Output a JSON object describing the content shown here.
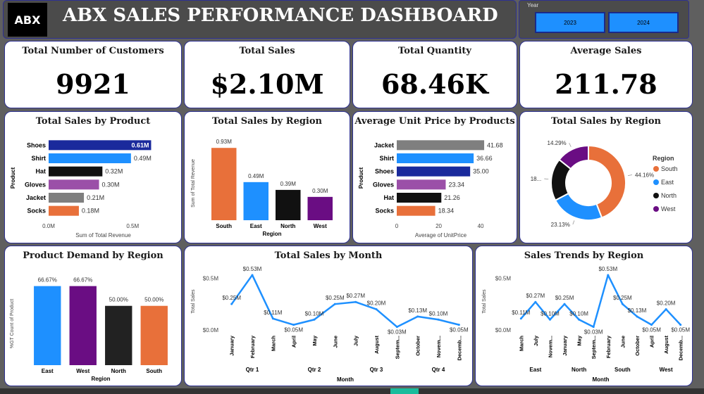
{
  "header": {
    "logo_text": "ABX",
    "title": "ABX SALES PERFORMANCE DASHBOARD"
  },
  "slicer": {
    "label": "Year",
    "options": [
      "2023",
      "2024"
    ]
  },
  "colors": {
    "accent_blue": "#1e90ff",
    "navy": "#1a2a9c",
    "orange": "#e8703a",
    "black": "#111111",
    "purple": "#6a0d83",
    "gray": "#7f7f7f",
    "violet": "#9b4fa8"
  },
  "kpis": [
    {
      "title": "Total Number of Customers",
      "value": "9921"
    },
    {
      "title": "Total Sales",
      "value": "$2.10M"
    },
    {
      "title": "Total Quantity",
      "value": "68.46K"
    },
    {
      "title": "Average Sales",
      "value": "211.78"
    }
  ],
  "chart_data": [
    {
      "id": "product",
      "type": "bar",
      "title": "Total Sales by Product",
      "orientation": "horizontal",
      "categories": [
        "Shoes",
        "Shirt",
        "Hat",
        "Gloves",
        "Jacket",
        "Socks"
      ],
      "values": [
        0.61,
        0.49,
        0.32,
        0.3,
        0.21,
        0.18
      ],
      "labels": [
        "0.61M",
        "0.49M",
        "0.32M",
        "0.30M",
        "0.21M",
        "0.18M"
      ],
      "colors": [
        "#1a2a9c",
        "#1e90ff",
        "#111111",
        "#9b4fa8",
        "#7f7f7f",
        "#e8703a"
      ],
      "xlabel": "Sum of Total Revenue",
      "ylabel": "Product",
      "xticks": [
        "0.0M",
        "0.5M"
      ],
      "xlim": [
        0,
        0.65
      ]
    },
    {
      "id": "region",
      "type": "bar",
      "title": "Total Sales by Region",
      "categories": [
        "South",
        "East",
        "North",
        "West"
      ],
      "values": [
        0.93,
        0.49,
        0.39,
        0.3
      ],
      "labels": [
        "0.93M",
        "0.49M",
        "0.39M",
        "0.30M"
      ],
      "colors": [
        "#e8703a",
        "#1e90ff",
        "#111111",
        "#6a0d83"
      ],
      "xlabel": "Region",
      "ylabel": "Sum of Total Revenue",
      "ylim": [
        0,
        0.95
      ]
    },
    {
      "id": "price",
      "type": "bar",
      "title": "Average Unit Price by Products",
      "orientation": "horizontal",
      "categories": [
        "Jacket",
        "Shirt",
        "Shoes",
        "Gloves",
        "Hat",
        "Socks"
      ],
      "values": [
        41.68,
        36.66,
        35.0,
        23.34,
        21.26,
        18.34
      ],
      "labels": [
        "41.68",
        "36.66",
        "35.00",
        "23.34",
        "21.26",
        "18.34"
      ],
      "colors": [
        "#7f7f7f",
        "#1e90ff",
        "#1a2a9c",
        "#9b4fa8",
        "#111111",
        "#e8703a"
      ],
      "xlabel": "Average of UnitPrice",
      "ylabel": "Product",
      "xticks": [
        "0",
        "20",
        "40"
      ],
      "xtick_values": [
        0,
        20,
        40
      ],
      "xlim": [
        0,
        42
      ]
    },
    {
      "id": "donut",
      "type": "pie",
      "title": "Total Sales by Region",
      "categories": [
        "South",
        "East",
        "North",
        "West"
      ],
      "values": [
        44.16,
        23.13,
        18.42,
        14.29
      ],
      "labels": [
        "44.16%",
        "23.13%",
        "18...",
        "14.29%"
      ],
      "colors": [
        "#e8703a",
        "#1e90ff",
        "#111111",
        "#6a0d83"
      ],
      "legend_title": "Region",
      "legend_position": "right"
    },
    {
      "id": "demand",
      "type": "bar",
      "title": "Product Demand by Region",
      "categories": [
        "East",
        "West",
        "North",
        "South"
      ],
      "values": [
        66.67,
        66.67,
        50.0,
        50.0
      ],
      "labels": [
        "66.67%",
        "66.67%",
        "50.00%",
        "50.00%"
      ],
      "colors": [
        "#1e90ff",
        "#6a0d83",
        "#222222",
        "#e8703a"
      ],
      "xlabel": "Region",
      "ylabel": "%GT Count of Product",
      "ylim": [
        0,
        70
      ]
    },
    {
      "id": "month",
      "type": "line",
      "title": "Total Sales by Month",
      "categories": [
        "January",
        "February",
        "March",
        "April",
        "May",
        "June",
        "July",
        "August",
        "Septem...",
        "October",
        "Novem...",
        "Decemb..."
      ],
      "values": [
        0.25,
        0.53,
        0.11,
        0.05,
        0.1,
        0.25,
        0.27,
        0.2,
        0.03,
        0.13,
        0.1,
        0.05
      ],
      "labels": [
        "$0.25M",
        "$0.53M",
        "$0.11M",
        "$0.05M",
        "$0.10M",
        "$0.25M",
        "$0.27M",
        "$0.20M",
        "$0.03M",
        "$0.13M",
        "$0.10M",
        "$0.05M"
      ],
      "groups": [
        "Qtr 1",
        "Qtr 2",
        "Qtr 3",
        "Qtr 4"
      ],
      "xlabel": "Month",
      "ylabel": "Total Sales",
      "yticks": [
        "$0.0M",
        "$0.5M"
      ],
      "ylim": [
        0,
        0.55
      ],
      "color": "#1e90ff"
    },
    {
      "id": "trend",
      "type": "line",
      "title": "Sales Trends by Region",
      "categories": [
        "March",
        "July",
        "Novem...",
        "January",
        "May",
        "Septem...",
        "February",
        "June",
        "October",
        "April",
        "August",
        "Decemb..."
      ],
      "values": [
        0.11,
        0.27,
        0.1,
        0.25,
        0.1,
        0.03,
        0.53,
        0.25,
        0.13,
        0.05,
        0.2,
        0.05
      ],
      "labels": [
        "$0.11M",
        "$0.27M",
        "$0.10M",
        "$0.25M",
        "$0.10M",
        "$0.03M",
        "$0.53M",
        "$0.25M",
        "$0.13M",
        "$0.05M",
        "$0.20M",
        "$0.05M"
      ],
      "groups": [
        "East",
        "North",
        "South",
        "West"
      ],
      "xlabel": "Month",
      "ylabel": "Total Sales",
      "yticks": [
        "$0.0M",
        "$0.5M"
      ],
      "ylim": [
        0,
        0.55
      ],
      "color": "#1e90ff"
    }
  ]
}
